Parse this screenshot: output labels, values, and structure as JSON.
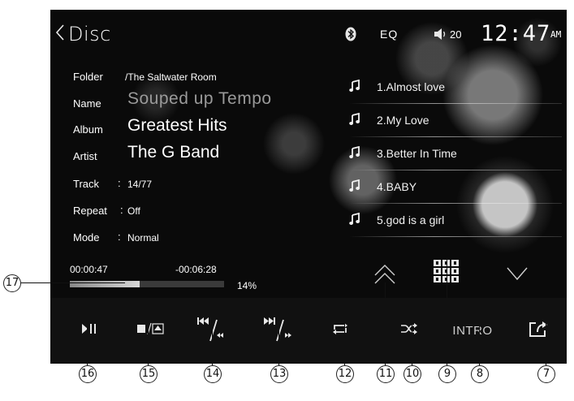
{
  "header": {
    "back_icon": "chevron-left-icon",
    "title": "Disc",
    "bluetooth_icon": "bluetooth-icon",
    "eq_label": "EQ",
    "volume_icon": "speaker-icon",
    "volume_level": "20",
    "clock_time": "12:47",
    "clock_ampm": "AM"
  },
  "info": {
    "folder_label": "Folder",
    "folder_value": "/The Saltwater Room",
    "name_label": "Name",
    "name_value": "Souped up Tempo",
    "album_label": "Album",
    "album_value": "Greatest Hits",
    "artist_label": "Artist",
    "artist_value": "The G Band",
    "track_label": "Track",
    "track_value": "14/77",
    "repeat_label": "Repeat",
    "repeat_value": "Off",
    "mode_label": "Mode",
    "mode_value": "Normal"
  },
  "playlist": {
    "item_icon": "music-note-icon",
    "tracks": [
      "1.Almost love",
      "2.My Love",
      "3.Better In Time",
      "4.BABY",
      "5.god is a girl"
    ]
  },
  "progress": {
    "elapsed": "00:00:47",
    "remaining": "-00:06:28",
    "percent_label": "14%",
    "fraction": 0.14
  },
  "nav": {
    "page_up_icon": "double-chevron-up-icon",
    "keypad_icon": "keypad-icon",
    "page_down_icon": "chevron-down-icon"
  },
  "controls": {
    "play_pause_icon": "play-pause-icon",
    "stop_eject_icon": "stop-eject-icon",
    "prev_icon": "previous-rewind-icon",
    "next_icon": "next-fastforward-icon",
    "repeat_icon": "repeat-icon",
    "shuffle_icon": "shuffle-icon",
    "intro_label": "INTRO",
    "exit_icon": "exit-icon"
  },
  "callouts": [
    "17",
    "16",
    "15",
    "14",
    "13",
    "12",
    "11",
    "10",
    "9",
    "8",
    "7"
  ]
}
